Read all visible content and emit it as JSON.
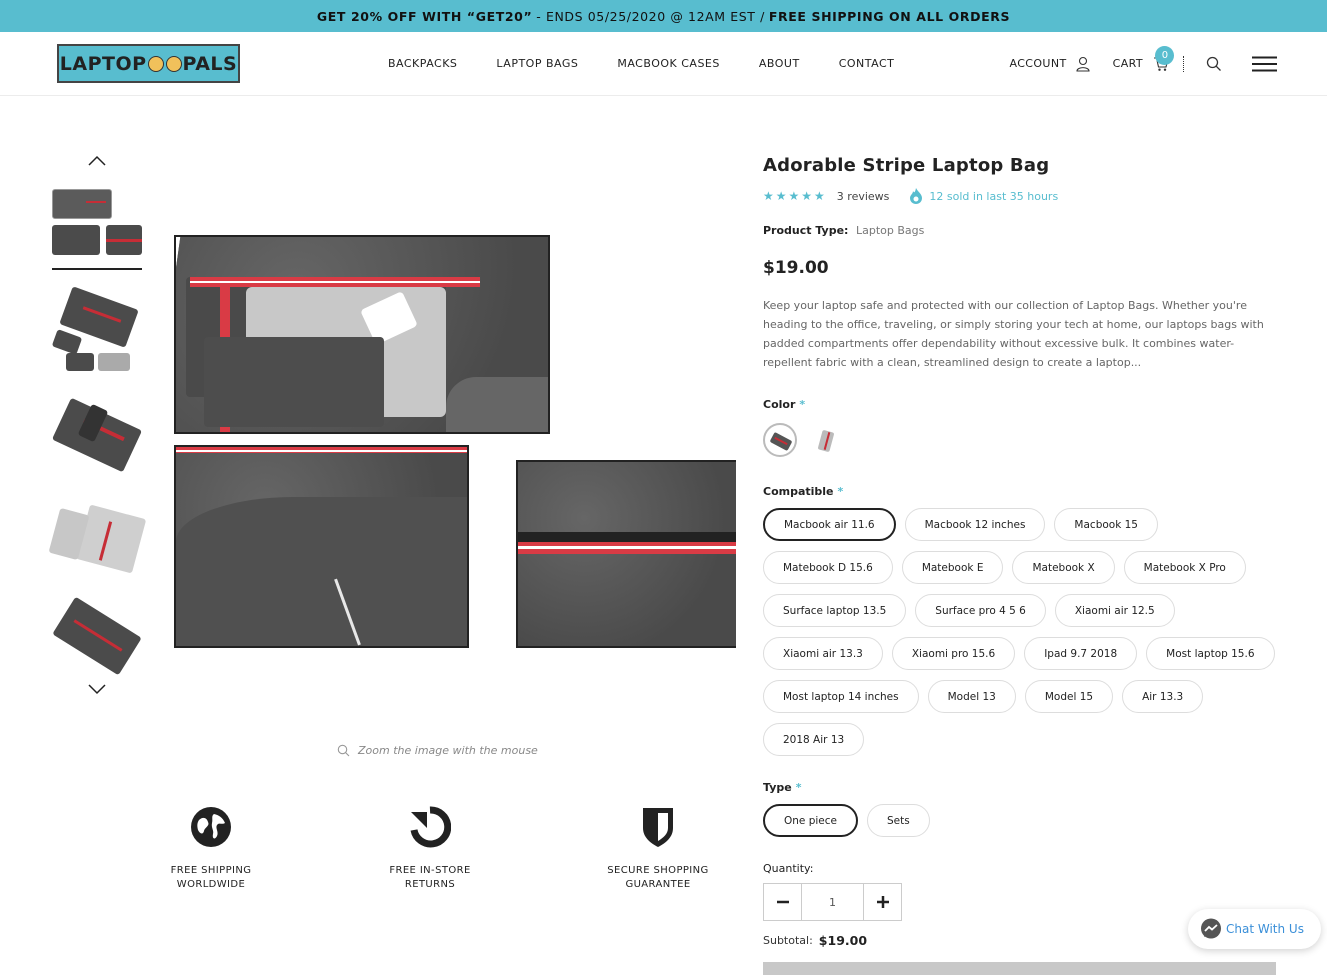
{
  "announcement": {
    "left": "GET 20% OFF WITH “GET20”",
    "middle": "- ENDS 05/25/2020 @ 12AM EST /",
    "right": "FREE SHIPPING ON ALL ORDERS"
  },
  "header": {
    "logo_text": "LAPTOP",
    "logo_text2": "PALS",
    "nav": [
      "BACKPACKS",
      "LAPTOP BAGS",
      "MACBOOK CASES",
      "ABOUT",
      "CONTACT"
    ],
    "account_label": "ACCOUNT",
    "cart_label": "CART",
    "cart_count": "0"
  },
  "gallery": {
    "zoom_hint": "Zoom the image with the mouse",
    "thumbnail_count": 6
  },
  "features": [
    {
      "line1": "FREE SHIPPING",
      "line2": "WORLDWIDE",
      "icon": "globe-icon"
    },
    {
      "line1": "FREE IN-STORE",
      "line2": "RETURNS",
      "icon": "return-arrow-icon"
    },
    {
      "line1": "SECURE SHOPPING",
      "line2": "GUARANTEE",
      "icon": "shield-icon"
    }
  ],
  "product": {
    "title": "Adorable Stripe Laptop Bag",
    "stars": "★★★★★",
    "reviews": "3 reviews",
    "sold": "12 sold in last 35 hours",
    "type_label": "Product Type:",
    "type_value": "Laptop Bags",
    "price": "$19.00",
    "description": "Keep your laptop safe and protected with our collection of Laptop Bags. Whether you're heading to the office, traveling, or simply storing your tech at home, our laptops bags with padded compartments offer dependability without excessive bulk. It combines water-repellent fabric with a clean, streamlined design to create a laptop...",
    "color_label": "Color",
    "required_mark": "*",
    "compatible_label": "Compatible",
    "compatible_options": [
      "Macbook air 11.6",
      "Macbook 12 inches",
      "Macbook 15",
      "Matebook D 15.6",
      "Matebook E",
      "Matebook X",
      "Matebook X Pro",
      "Surface laptop 13.5",
      "Surface pro 4 5 6",
      "Xiaomi air 12.5",
      "Xiaomi air 13.3",
      "Xiaomi pro 15.6",
      "Ipad 9.7 2018",
      "Most laptop 15.6",
      "Most laptop 14 inches",
      "Model 13",
      "Model 15",
      "Air 13.3",
      "2018 Air 13"
    ],
    "compatible_selected": "Macbook air 11.6",
    "type_option_label": "Type",
    "type_options": [
      "One piece",
      "Sets"
    ],
    "type_selected": "One piece",
    "quantity_label": "Quantity:",
    "quantity": "1",
    "subtotal_label": "Subtotal:",
    "subtotal": "$19.00"
  },
  "chat": {
    "label": "Chat With Us"
  },
  "colors": {
    "accent": "#58bdcf",
    "stripe": "#c62d36",
    "felt": "#4b4b4b"
  }
}
